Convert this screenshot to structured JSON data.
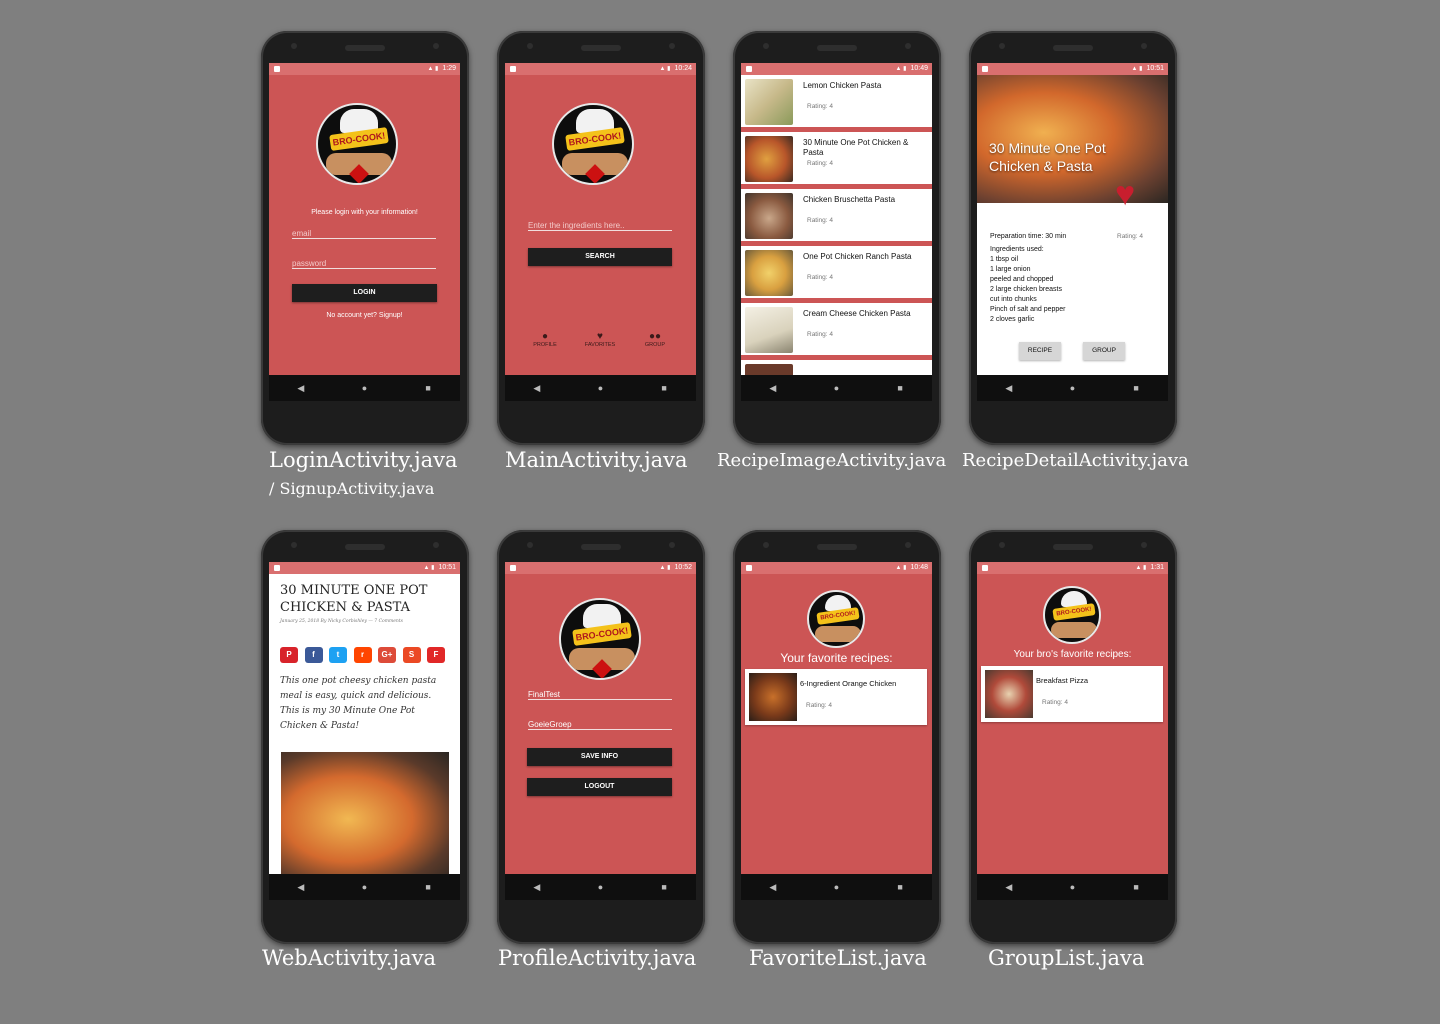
{
  "captions": {
    "login": "LoginActivity.java",
    "login_sub": "/ SignupActivity.java",
    "main": "MainActivity.java",
    "recipe_image": "RecipeImageActivity.java",
    "recipe_detail": "RecipeDetailActivity.java",
    "web": "WebActivity.java",
    "profile": "ProfileActivity.java",
    "favorite": "FavoriteList.java",
    "group": "GroupList.java"
  },
  "times": {
    "login": "1:29",
    "main": "10:24",
    "recipe_image": "10:49",
    "recipe_detail": "10:51",
    "web": "10:51",
    "profile": "10:52",
    "favorite": "10:48",
    "group": "1:31"
  },
  "logo_text": "BRO-COOK!",
  "nav_icons": {
    "back": "◀",
    "home": "●",
    "recents": "■"
  },
  "login": {
    "prompt": "Please login with your information!",
    "email_placeholder": "email",
    "password_placeholder": "password",
    "login_button": "LOGIN",
    "signup_link": "No account yet? Signup!"
  },
  "main": {
    "ingredients_placeholder": "Enter the ingredients here..",
    "search_button": "SEARCH",
    "tabs": [
      {
        "label": "PROFILE",
        "icon": "person-icon"
      },
      {
        "label": "FAVORITES",
        "icon": "heart-icon"
      },
      {
        "label": "GROUP",
        "icon": "group-icon"
      }
    ]
  },
  "recipes": [
    {
      "title": "Lemon Chicken Pasta",
      "rating": "Rating: 4"
    },
    {
      "title": "30 Minute One Pot Chicken & Pasta",
      "rating": "Rating: 4"
    },
    {
      "title": "Chicken Bruschetta Pasta",
      "rating": "Rating: 4"
    },
    {
      "title": "One Pot Chicken Ranch Pasta",
      "rating": "Rating: 4"
    },
    {
      "title": "Cream Cheese Chicken Pasta",
      "rating": "Rating: 4"
    }
  ],
  "detail": {
    "title": "30 Minute One Pot Chicken & Pasta",
    "prep_time": "Preparation time: 30 min",
    "rating": "Rating: 4",
    "ingredients": "Ingredients used:\n1 tbsp oil\n1 large onion\n peeled and chopped\n2 large chicken breasts\n cut into chunks\nPinch of salt and pepper\n2 cloves garlic",
    "recipe_button": "RECIPE",
    "group_button": "GROUP"
  },
  "web": {
    "title": "30 MINUTE ONE POT CHICKEN & PASTA",
    "byline": "January 25, 2018 By Nicky Corbishley — 7 Comments",
    "share_colors": [
      "#d8232a",
      "#3b5998",
      "#1da1f2",
      "#ff4500",
      "#dd4b39",
      "#eb4924",
      "#e12828"
    ],
    "body": "This one pot cheesy chicken pasta meal is easy, quick and delicious. This is my 30 Minute One Pot Chicken & Pasta!"
  },
  "profile": {
    "name_value": "FinalTest",
    "group_value": "GoeieGroep",
    "save_button": "SAVE INFO",
    "logout_button": "LOGOUT"
  },
  "favorite": {
    "heading": "Your favorite recipes:",
    "item_title": "6-Ingredient Orange Chicken",
    "item_rating": "Rating: 4"
  },
  "group": {
    "heading": "Your bro's favorite recipes:",
    "item_title": "Breakfast Pizza",
    "item_rating": "Rating: 4"
  },
  "colors": {
    "accent": "#cc5555",
    "statusbar": "#d96f6f",
    "button": "#1e1e1e"
  }
}
